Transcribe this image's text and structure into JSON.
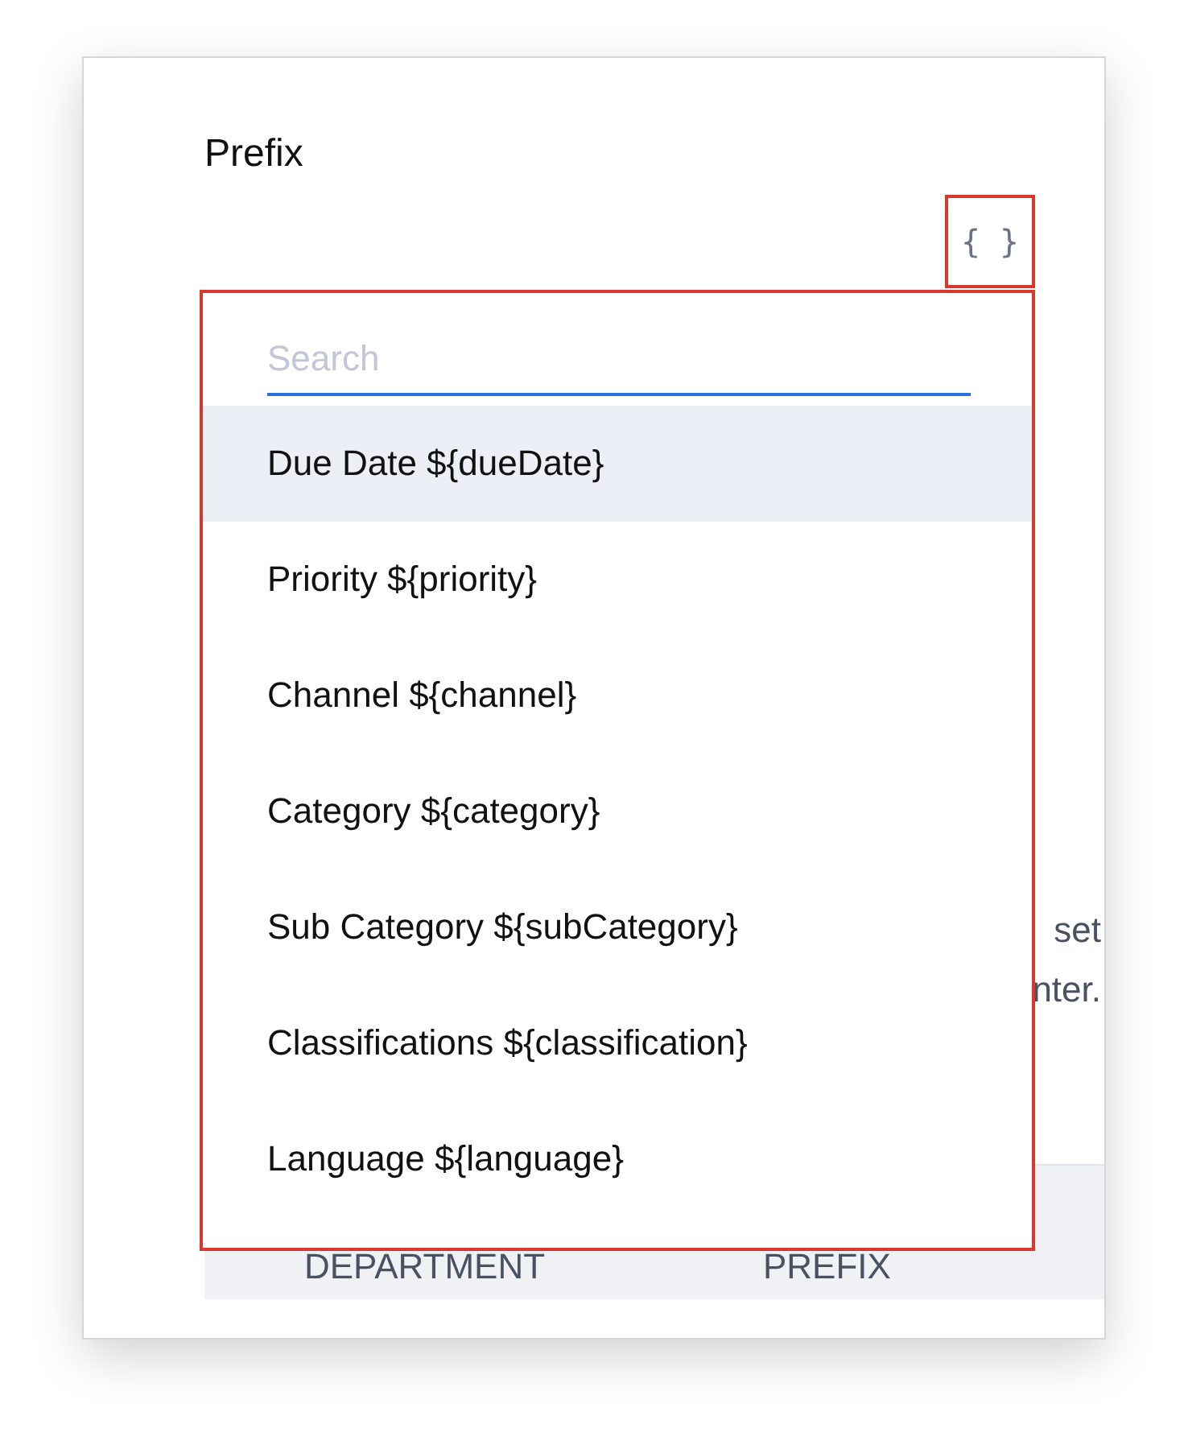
{
  "field": {
    "label": "Prefix",
    "button": "{ }"
  },
  "background_text": [
    "set",
    "nter."
  ],
  "table": {
    "columns": [
      "DEPARTMENT",
      "PREFIX"
    ]
  },
  "dropdown": {
    "search": {
      "placeholder": "Search"
    },
    "items": [
      {
        "label": "Due Date ${dueDate}",
        "selected": true
      },
      {
        "label": "Priority ${priority}",
        "selected": false
      },
      {
        "label": "Channel ${channel}",
        "selected": false
      },
      {
        "label": "Category ${category}",
        "selected": false
      },
      {
        "label": "Sub Category ${subCategory}",
        "selected": false
      },
      {
        "label": "Classifications ${classification}",
        "selected": false
      },
      {
        "label": "Language ${language}",
        "selected": false
      }
    ]
  }
}
